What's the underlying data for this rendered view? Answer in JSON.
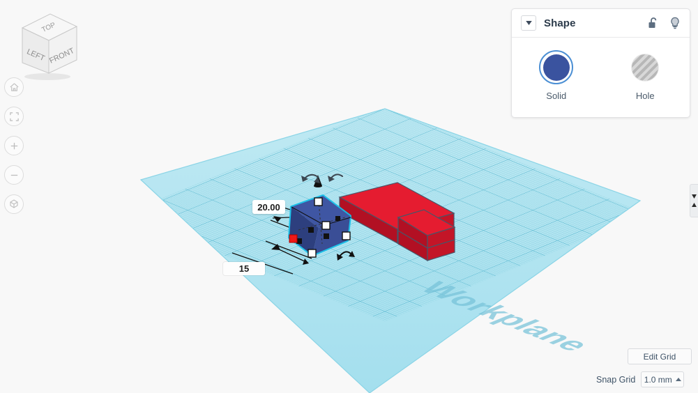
{
  "app": {
    "name": "tinkercad-3d-editor"
  },
  "viewcube": {
    "faces": {
      "top": "TOP",
      "left": "LEFT",
      "front": "FRONT"
    }
  },
  "nav_buttons": [
    {
      "name": "home-view-button",
      "icon": "home-icon"
    },
    {
      "name": "fit-to-view-button",
      "icon": "fit-frame-icon"
    },
    {
      "name": "zoom-in-button",
      "icon": "plus-icon"
    },
    {
      "name": "zoom-out-button",
      "icon": "minus-icon"
    },
    {
      "name": "projection-toggle-button",
      "icon": "cube-projection-icon"
    }
  ],
  "shape_panel": {
    "title": "Shape",
    "collapse_icon": "chevron-down-icon",
    "lock_icon": "unlocked-padlock-icon",
    "bulb_icon": "lightbulb-icon",
    "options": [
      {
        "label": "Solid",
        "icon": "solid-circle-icon",
        "selected": true,
        "color": "#3a539f"
      },
      {
        "label": "Hole",
        "icon": "hatched-circle-icon",
        "selected": false,
        "color": "#b7b7b7"
      }
    ]
  },
  "workplane": {
    "watermark": "Workplane",
    "grid_color": "#7ececf",
    "plane_color": "#a8e2ef"
  },
  "dimensions": {
    "depth": "20.00",
    "width": "15"
  },
  "objects": [
    {
      "name": "selected-blue-box",
      "color": "#3a539f",
      "selected": true,
      "outline": "#16c0e8"
    },
    {
      "name": "red-long-box",
      "color": "#e8182f",
      "selected": false
    },
    {
      "name": "red-short-box-upper",
      "color": "#e8182f",
      "selected": false
    },
    {
      "name": "red-short-box-lower",
      "color": "#e8182f",
      "selected": false
    }
  ],
  "bottom_bar": {
    "edit_grid_label": "Edit Grid",
    "snap_grid_label": "Snap Grid",
    "snap_grid_value": "1.0 mm",
    "snap_grid_caret": "caret-up-icon"
  },
  "right_stub": {
    "name": "collapsed-side-panel",
    "icons": [
      "caret-down-icon",
      "caret-up-icon"
    ]
  }
}
